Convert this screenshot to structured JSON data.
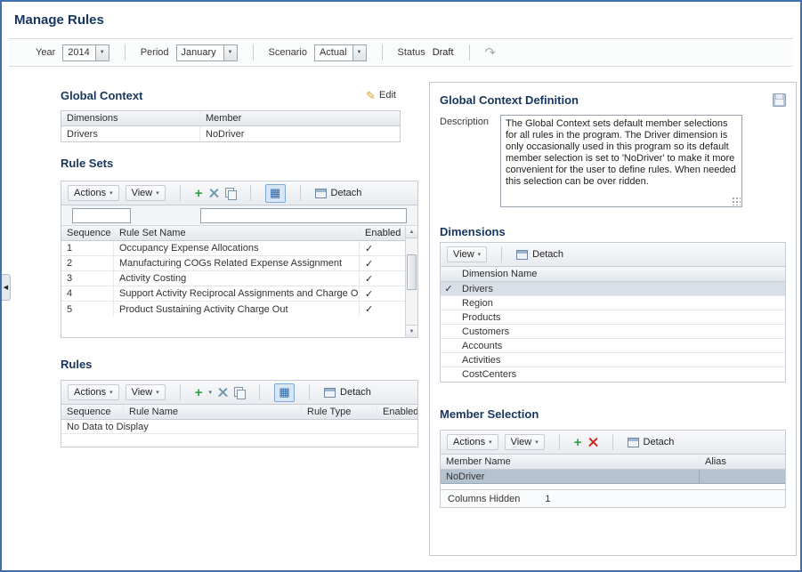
{
  "icons": {
    "check": "✓",
    "dropdown": "▼",
    "caret": "▾",
    "plus": "+",
    "pencil": "✎",
    "redo": "↷",
    "collapse": "◀",
    "grid": "▦",
    "up": "▲",
    "down": "▼"
  },
  "page": {
    "title": "Manage Rules"
  },
  "filters": {
    "year_label": "Year",
    "year_value": "2014",
    "period_label": "Period",
    "period_value": "January",
    "scenario_label": "Scenario",
    "scenario_value": "Actual",
    "status_label": "Status",
    "status_value": "Draft"
  },
  "global_context": {
    "title": "Global Context",
    "edit_label": "Edit",
    "col_dimensions": "Dimensions",
    "col_member": "Member",
    "rows": [
      {
        "dimension": "Drivers",
        "member": "NoDriver"
      }
    ]
  },
  "rule_sets": {
    "title": "Rule Sets",
    "actions_label": "Actions",
    "view_label": "View",
    "detach_label": "Detach",
    "col_sequence": "Sequence",
    "col_name": "Rule Set Name",
    "col_enabled": "Enabled",
    "rows": [
      {
        "sequence": "1",
        "name": "Occupancy Expense Allocations",
        "enabled": "✓"
      },
      {
        "sequence": "2",
        "name": "Manufacturing COGs Related Expense Assignment",
        "enabled": "✓"
      },
      {
        "sequence": "3",
        "name": "Activity Costing",
        "enabled": "✓"
      },
      {
        "sequence": "4",
        "name": "Support Activity Reciprocal Assignments and Charge Out",
        "enabled": "✓"
      },
      {
        "sequence": "5",
        "name": "Product Sustaining Activity Charge Out",
        "enabled": "✓"
      }
    ]
  },
  "rules": {
    "title": "Rules",
    "actions_label": "Actions",
    "view_label": "View",
    "detach_label": "Detach",
    "col_sequence": "Sequence",
    "col_name": "Rule Name",
    "col_type": "Rule Type",
    "col_enabled": "Enabled",
    "empty_text": "No Data to Display"
  },
  "definition": {
    "title": "Global Context Definition",
    "description_label": "Description",
    "description_text": "The Global Context sets default member selections for all rules in the program. The Driver dimension is only occasionally used in this program so its default member selection is set to 'NoDriver' to make it more convenient for the user to define rules. When needed this selection can be over ridden."
  },
  "dimensions": {
    "title": "Dimensions",
    "view_label": "View",
    "detach_label": "Detach",
    "col_name": "Dimension Name",
    "rows": [
      {
        "name": "Drivers",
        "selected": "✓"
      },
      {
        "name": "Region",
        "selected": ""
      },
      {
        "name": "Products",
        "selected": ""
      },
      {
        "name": "Customers",
        "selected": ""
      },
      {
        "name": "Accounts",
        "selected": ""
      },
      {
        "name": "Activities",
        "selected": ""
      },
      {
        "name": "CostCenters",
        "selected": ""
      }
    ]
  },
  "member_selection": {
    "title": "Member Selection",
    "actions_label": "Actions",
    "view_label": "View",
    "detach_label": "Detach",
    "col_member": "Member Name",
    "col_alias": "Alias",
    "rows": [
      {
        "member": "NoDriver",
        "alias": ""
      }
    ],
    "footer_label": "Columns Hidden",
    "footer_value": "1"
  }
}
